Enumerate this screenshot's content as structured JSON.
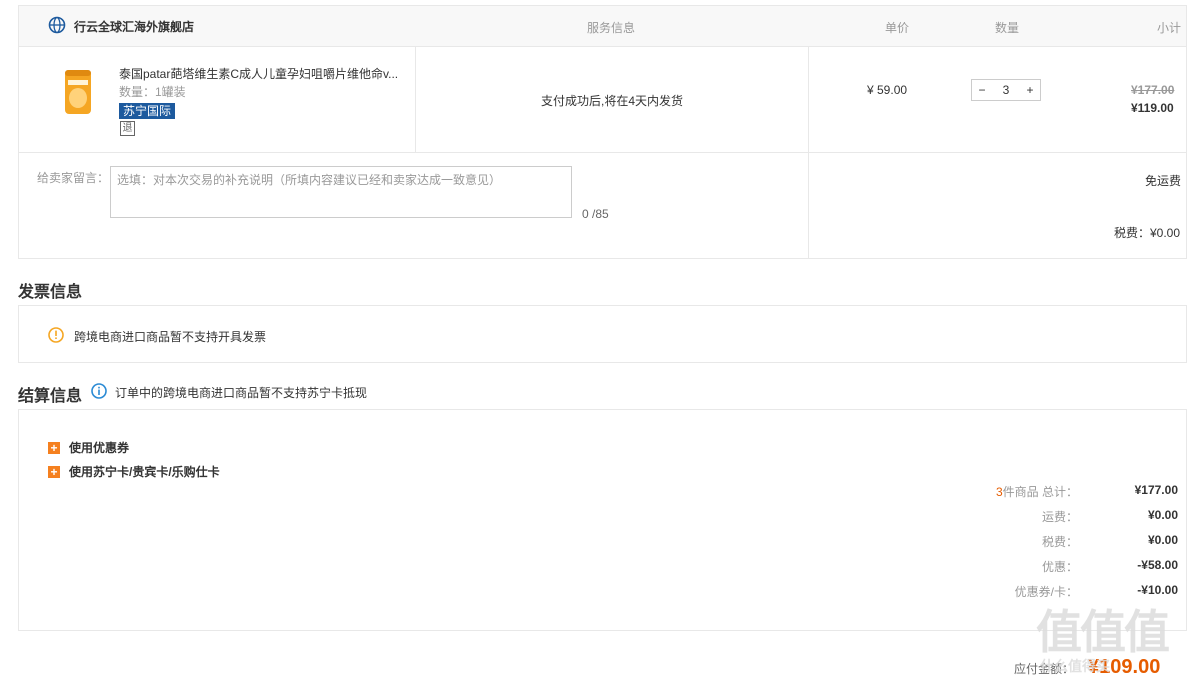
{
  "store": {
    "name": "行云全球汇海外旗舰店"
  },
  "table_header": {
    "service": "服务信息",
    "unit_price": "单价",
    "quantity": "数量",
    "subtotal": "小计"
  },
  "product": {
    "title": "泰国patar葩塔维生素C成人儿童孕妇咀嚼片维他命v...",
    "qty_text": "数量：1罐装",
    "badge": "苏宁国际",
    "return_tag": "退",
    "service": "支付成功后,将在4天内发货",
    "unit_price": "¥ 59.00",
    "quantity": "3",
    "minus": "−",
    "plus": "+",
    "original_subtotal": "¥177.00",
    "subtotal": "¥119.00"
  },
  "message": {
    "label": "给卖家留言：",
    "placeholder": "选填：对本次交易的补充说明（所填内容建议已经和卖家达成一致意见）",
    "count": "0 /85",
    "shipping": "免运费",
    "tax": "税费：¥0.00"
  },
  "invoice": {
    "title": "发票信息",
    "notice": "跨境电商进口商品暂不支持开具发票"
  },
  "settle": {
    "title": "结算信息",
    "notice": "订单中的跨境电商进口商品暂不支持苏宁卡抵现",
    "coupon": "使用优惠券",
    "cards": "使用苏宁卡/贵宾卡/乐购仕卡",
    "items_count": "3",
    "items_label": "件商品 总计：",
    "total": "¥177.00",
    "freight_label": "运费：",
    "freight": "¥0.00",
    "tax_label": "税费：",
    "tax": "¥0.00",
    "discount_label": "优惠：",
    "discount": "-¥58.00",
    "coupon_label": "优惠券/卡：",
    "coupon_value": "-¥10.00",
    "pay_label": "应付金额：",
    "pay_value": "¥109.00"
  },
  "watermark": {
    "text": "值值值",
    "sub": "什么值得买"
  },
  "colors": {
    "accent": "#f5801f",
    "badge_bg": "#1d5a9e",
    "price_orange": "#e65c00",
    "info_blue": "#2a8ad4"
  }
}
